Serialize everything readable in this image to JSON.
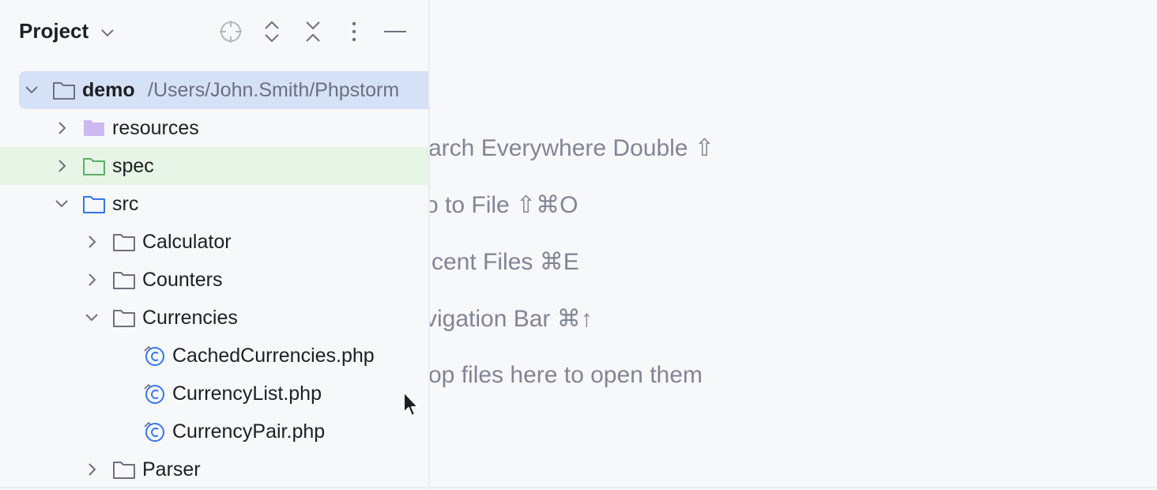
{
  "panel": {
    "title": "Project",
    "title_chevron_icon": "chevron-down-icon",
    "toolbar": [
      {
        "name": "locate-icon"
      },
      {
        "name": "expand-all-icon"
      },
      {
        "name": "collapse-all-icon"
      },
      {
        "name": "more-options-icon"
      },
      {
        "name": "hide-panel-icon"
      }
    ]
  },
  "tree": {
    "root": {
      "label": "demo",
      "path": "/Users/John.Smith/Phpstorm"
    },
    "items": [
      {
        "label": "resources"
      },
      {
        "label": "spec"
      },
      {
        "label": "src"
      },
      {
        "label": "Calculator"
      },
      {
        "label": "Counters"
      },
      {
        "label": "Currencies"
      },
      {
        "label": "CachedCurrencies.php"
      },
      {
        "label": "CurrencyList.php"
      },
      {
        "label": "CurrencyPair.php"
      },
      {
        "label": "Parser"
      }
    ]
  },
  "editor_hints": [
    "arch Everywhere Double ⇧",
    "o to File ⇧⌘O",
    "cent Files ⌘E",
    "vigation Bar ⌘↑",
    "op files here to open them"
  ],
  "colors": {
    "background": "#f7f8fa",
    "selection": "#d5e1f7",
    "test_root_highlight": "#e6f5e6",
    "resources_folder": "#cbb8f0",
    "test_folder": "#5fad65",
    "source_folder": "#3574f0",
    "hint_text": "#818594"
  }
}
